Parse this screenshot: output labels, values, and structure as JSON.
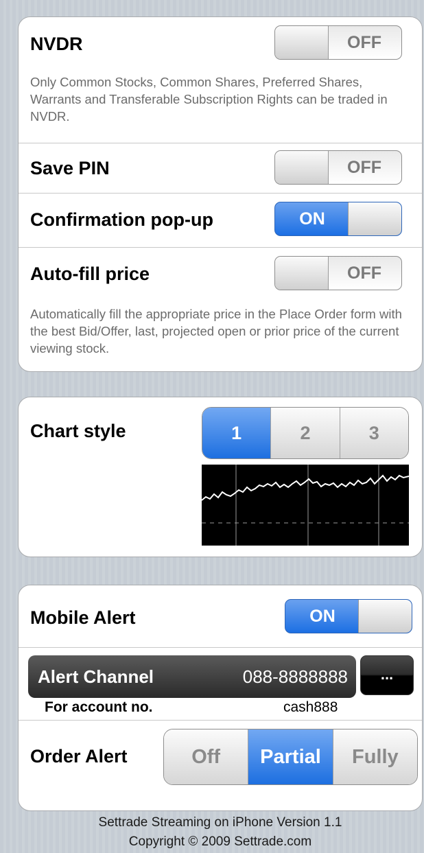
{
  "preferences": {
    "nvdr": {
      "label": "NVDR",
      "state": "OFF",
      "description": "Only Common Stocks, Common Shares, Preferred Shares, Warrants and Transferable Subscription Rights can be traded in NVDR."
    },
    "save_pin": {
      "label": "Save PIN",
      "state": "OFF"
    },
    "confirmation_popup": {
      "label": "Confirmation pop-up",
      "state": "ON"
    },
    "auto_fill_price": {
      "label": "Auto-fill price",
      "state": "OFF",
      "description": "Automatically fill the appropriate price in the Place Order form with the best Bid/Offer, last, projected open or prior price of the current viewing stock."
    }
  },
  "chart_style": {
    "label": "Chart style",
    "options": [
      "1",
      "2",
      "3"
    ],
    "selected": "1"
  },
  "alerts": {
    "mobile_alert": {
      "label": "Mobile Alert",
      "state": "ON"
    },
    "alert_channel": {
      "label": "Alert Channel",
      "value": "088-8888888",
      "button": "..."
    },
    "account": {
      "label": "For account no.",
      "value": "cash888"
    },
    "order_alert": {
      "label": "Order Alert",
      "options": [
        "Off",
        "Partial",
        "Fully"
      ],
      "selected": "Partial"
    }
  },
  "footer": {
    "version": "Settrade Streaming on iPhone Version 1.1",
    "copyright": "Copyright © 2009 Settrade.com"
  },
  "colors": {
    "accent_blue": "#1c6fe3",
    "background": "#c5ccd4"
  }
}
